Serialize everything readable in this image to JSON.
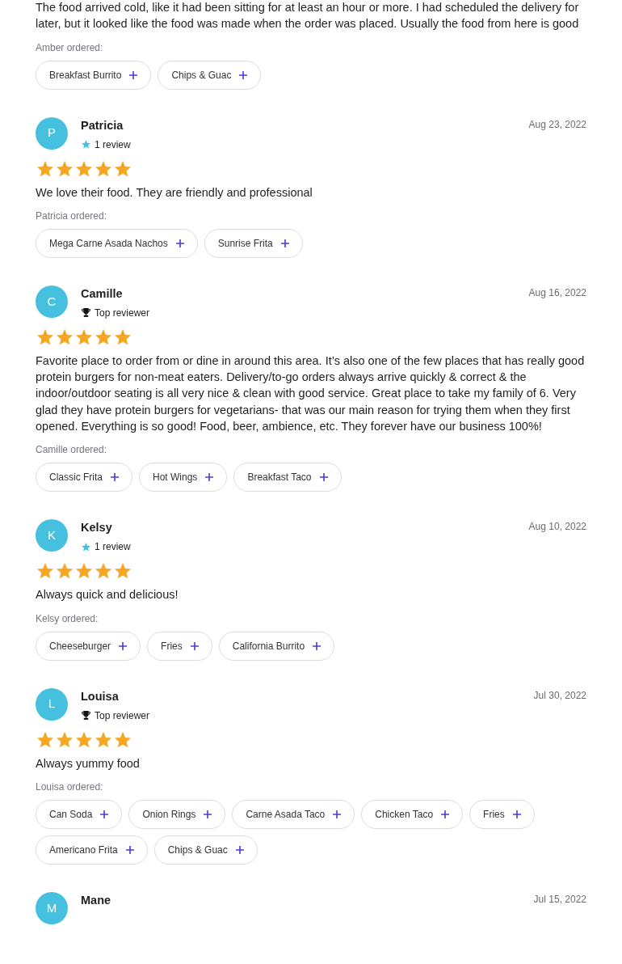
{
  "reviews": [
    {
      "text": "The food arrived cold, like it had been sitting for at least an hour or more. I had scheduled the delivery for later, but it looked like the food was made when the order was placed. Usually the food from here is good",
      "ordered_label": "Amber ordered:",
      "items": [
        "Breakfast Burrito",
        "Chips & Guac"
      ]
    },
    {
      "avatar": "P",
      "name": "Patricia",
      "date": "Aug 23, 2022",
      "badge": {
        "kind": "star",
        "label": "1 review"
      },
      "stars": 5,
      "text": "We love their food. They are friendly and professional",
      "ordered_label": "Patricia ordered:",
      "items": [
        "Mega Carne Asada Nachos",
        "Sunrise Frita"
      ]
    },
    {
      "avatar": "C",
      "name": "Camille",
      "date": "Aug 16, 2022",
      "badge": {
        "kind": "trophy",
        "label": "Top reviewer"
      },
      "stars": 5,
      "text": "Favorite place to order from or dine in around this area. It’s also one of the few places that has really good protein burgers for non-meat eaters. Delivery/to-go orders always arrive quickly & correct & the indoor/outdoor seating is all very nice & clean with good service. Great place to take my family of 6. Very glad they have protein burgers for vegetarians- that was our main reason for trying them when they first opened. Everything is so good! Food, beer, ambience, etc. They forever have our business 100%!",
      "ordered_label": "Camille ordered:",
      "items": [
        "Classic Frita",
        "Hot Wings",
        "Breakfast Taco"
      ]
    },
    {
      "avatar": "K",
      "name": "Kelsy",
      "date": "Aug 10, 2022",
      "badge": {
        "kind": "star",
        "label": "1 review"
      },
      "stars": 5,
      "text": "Always quick and delicious!",
      "ordered_label": "Kelsy ordered:",
      "items": [
        "Cheeseburger",
        "Fries",
        "California Burrito"
      ]
    },
    {
      "avatar": "L",
      "name": "Louisa",
      "date": "Jul 30, 2022",
      "badge": {
        "kind": "trophy",
        "label": "Top reviewer"
      },
      "stars": 5,
      "text": "Always yummy food",
      "ordered_label": "Louisa ordered:",
      "items": [
        "Can Soda",
        "Onion Rings",
        "Carne Asada Taco",
        "Chicken Taco",
        "Fries",
        "Americano Frita",
        "Chips & Guac"
      ]
    },
    {
      "avatar": "M",
      "name": "Mane",
      "date": "Jul 15, 2022"
    }
  ]
}
